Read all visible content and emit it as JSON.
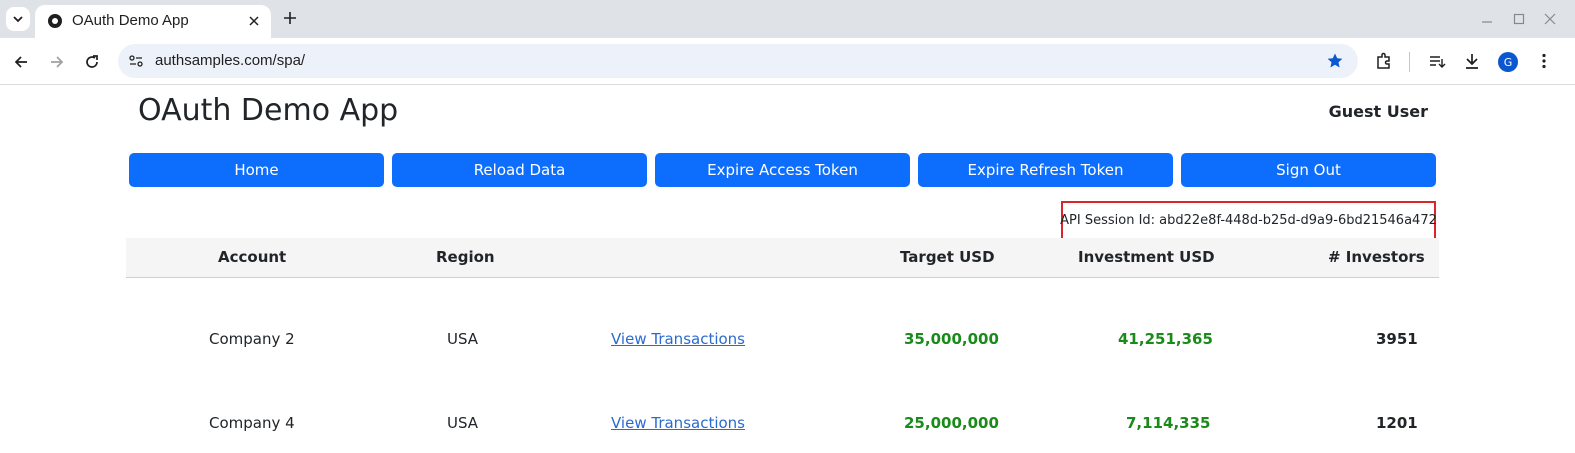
{
  "browser": {
    "tab_title": "OAuth Demo App",
    "url": "authsamples.com/spa/",
    "profile_initial": "G"
  },
  "app": {
    "title": "OAuth Demo App",
    "user": "Guest User"
  },
  "nav": {
    "buttons": [
      "Home",
      "Reload Data",
      "Expire Access Token",
      "Expire Refresh Token",
      "Sign Out"
    ]
  },
  "session": {
    "text": "API Session Id: abd22e8f-448d-b25d-d9a9-6bd21546a472"
  },
  "table": {
    "headers": [
      "Account",
      "Region",
      "Target USD",
      "Investment USD",
      "# Investors"
    ],
    "rows": [
      {
        "account": "Company 2",
        "region": "USA",
        "link": "View Transactions",
        "target": "35,000,000",
        "investment": "41,251,365",
        "investors": "3951"
      },
      {
        "account": "Company 4",
        "region": "USA",
        "link": "View Transactions",
        "target": "25,000,000",
        "investment": "7,114,335",
        "investors": "1201"
      }
    ]
  },
  "colors": {
    "button": "#0d6efd",
    "highlight_border": "#d9262c",
    "positive": "#1a8a1a",
    "link": "#2a6bd1"
  }
}
